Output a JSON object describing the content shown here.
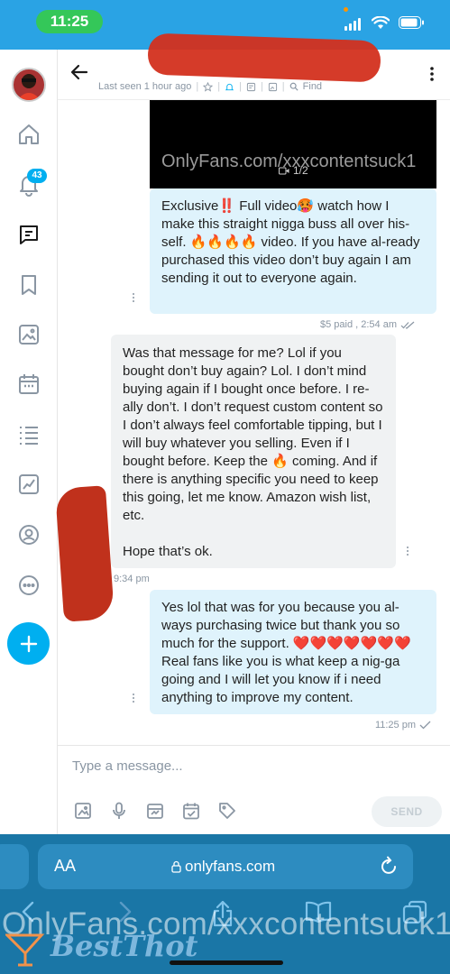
{
  "status_bar": {
    "time": "11:25"
  },
  "sidebar": {
    "notifications_badge": "43"
  },
  "header": {
    "last_seen": "Last seen 1 hour ago",
    "find_label": "Find"
  },
  "messages": [
    {
      "direction": "outgoing",
      "video_caption": "OnlyFans.com/xxxcontentsuck1",
      "video_counter": "1/2",
      "text": "Exclusive‼️ Full video🥵 watch how I make this straight nigga buss all over his-self. 🔥🔥🔥🔥 video. If you have al-ready purchased this video don’t buy again I am sending it out to everyone again.",
      "meta": "$5 paid , 2:54 am"
    },
    {
      "direction": "incoming",
      "text": "Was that message for me? Lol if you bought don’t buy again? Lol. I don’t mind buying again if I bought once before. I re-ally don’t. I don’t request custom content so I don’t always feel comfortable tipping, but I will buy whatever you selling. Even if I bought before. Keep the 🔥 coming. And if there is anything specific you need to keep this going, let me know. Amazon wish list, etc.\n\nHope that’s ok.",
      "meta": "9:34 pm"
    },
    {
      "direction": "outgoing",
      "text": "Yes lol that was for you because you al-ways purchasing twice but thank you so much for the support. ❤️❤️❤️❤️❤️❤️❤️ Real fans like you is what keep a nig-ga going and I will let you know if i need anything to improve my content.",
      "meta": "11:25 pm"
    }
  ],
  "composer": {
    "placeholder": "Type a message...",
    "send_label": "SEND"
  },
  "browser": {
    "aa_label": "AA",
    "url": "onlyfans.com"
  },
  "overlay": {
    "watermark": "OnlyFans.com/xxxcontentsuck1",
    "logo_text": "BestThot"
  }
}
